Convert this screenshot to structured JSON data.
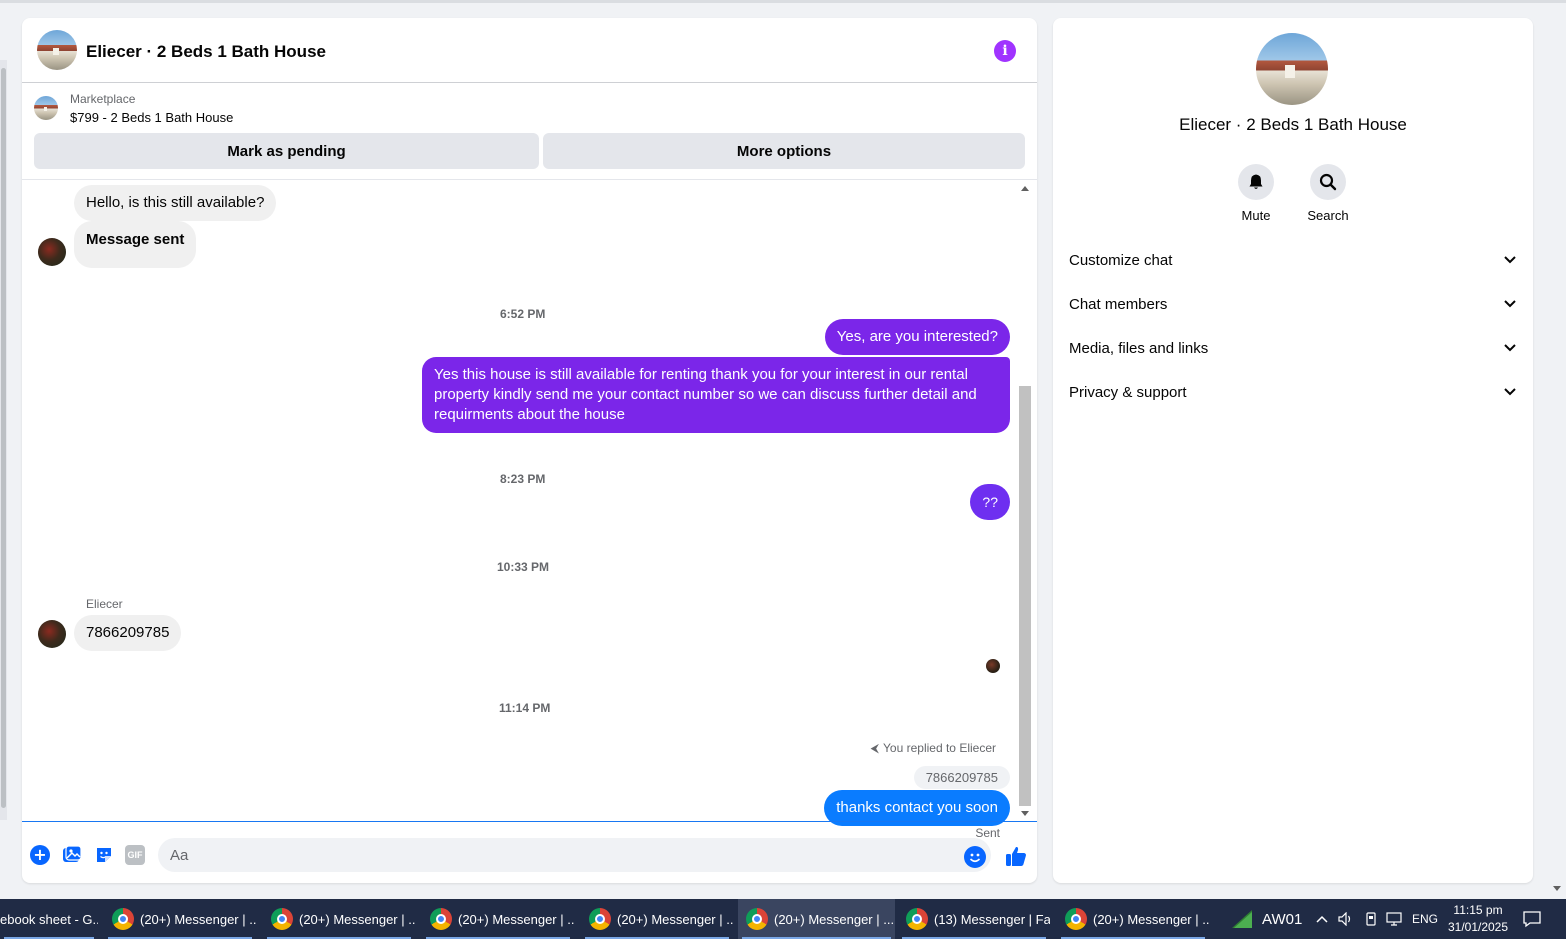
{
  "chat": {
    "title": "Eliecer · 2 Beds 1 Bath House",
    "marketplace_label": "Marketplace",
    "listing_line": "$799 - 2 Beds 1 Bath House",
    "mark_pending": "Mark as pending",
    "more_options": "More options"
  },
  "messages": {
    "m1": "Hello, is this still available?",
    "m2": "Message sent",
    "ts1": "6:52 PM",
    "m3": "Yes, are you interested?",
    "m4": "Yes this house is still available for renting thank you for your interest in our rental property kindly send me your contact number so we can discuss further detail and requirments about the house",
    "ts2": "8:23 PM",
    "m5": "??",
    "ts3": "10:33 PM",
    "sender": "Eliecer",
    "m6": "7866209785",
    "ts4": "11:14 PM",
    "replied_label": "You replied to Eliecer",
    "quoted": "7866209785",
    "m7": "thanks contact you soon",
    "status": "Sent"
  },
  "composer": {
    "placeholder": "Aa",
    "gif": "GIF"
  },
  "info_panel": {
    "name": "Eliecer · 2 Beds 1 Bath House",
    "mute": "Mute",
    "search": "Search",
    "sections": [
      "Customize chat",
      "Chat members",
      "Media, files and links",
      "Privacy & support"
    ]
  },
  "taskbar": {
    "items": [
      "ebook sheet - G...",
      "(20+) Messenger | ...",
      "(20+) Messenger | ...",
      "(20+) Messenger | ...",
      "(20+) Messenger | ...",
      "(20+) Messenger | ...",
      "(13) Messenger | Fa...",
      "(20+) Messenger | ..."
    ],
    "network_label": "AW01",
    "language": "ENG",
    "time": "11:15 pm",
    "date": "31/01/2025"
  },
  "colors": {
    "accent_blue": "#0866ff",
    "bubble_purple": "#7b26e9",
    "bubble_blue": "#0a7cff",
    "info_purple": "#a033ff"
  }
}
